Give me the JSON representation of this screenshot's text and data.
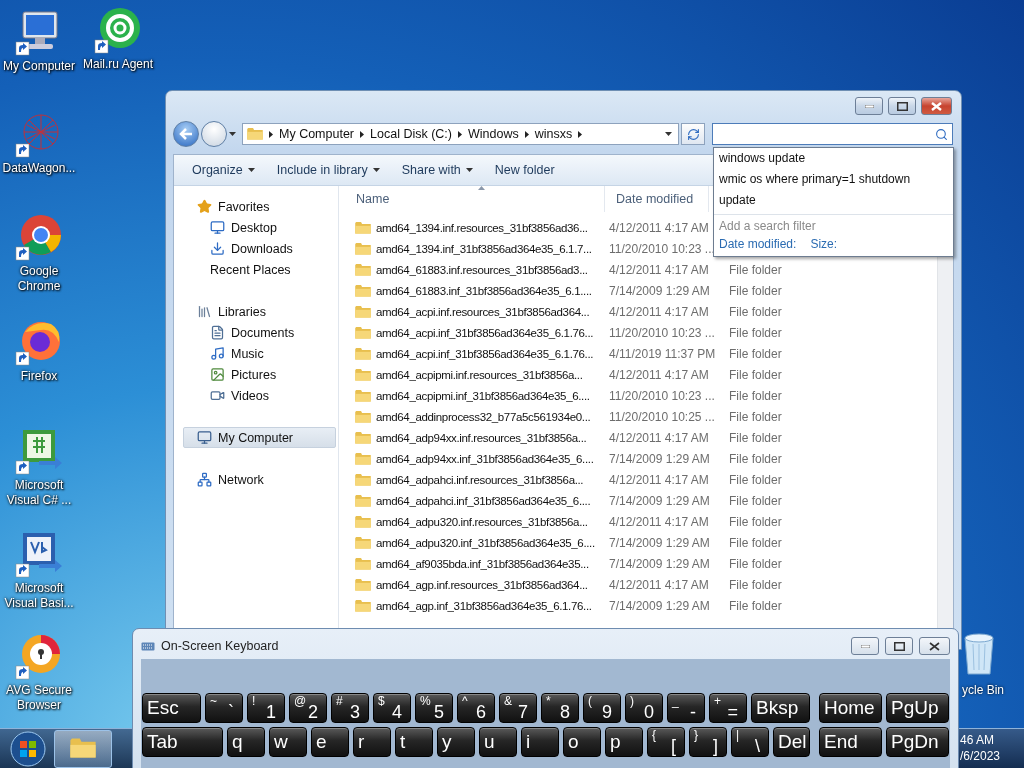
{
  "desktop_icons": [
    {
      "label": "My Computer",
      "kind": "computer"
    },
    {
      "label": "Mail.ru Agent",
      "kind": "mail"
    },
    {
      "label": "DataWagon...",
      "kind": "web"
    },
    {
      "label": "Google Chrome",
      "kind": "chrome"
    },
    {
      "label": "Firefox",
      "kind": "firefox"
    },
    {
      "label": "Microsoft Visual C# ...",
      "kind": "csharp"
    },
    {
      "label": "Microsoft Visual Basi...",
      "kind": "vb"
    },
    {
      "label": "AVG Secure Browser",
      "kind": "avg"
    }
  ],
  "recycle_bin": {
    "label": "ycle Bin"
  },
  "explorer": {
    "breadcrumbs": [
      "My Computer",
      "Local Disk (C:)",
      "Windows",
      "winsxs"
    ],
    "search": {
      "suggestions": [
        "windows update",
        "wmic os where primary=1 shutdown",
        "update"
      ],
      "filter_hint": "Add a search filter",
      "filters": [
        "Date modified:",
        "Size:"
      ]
    },
    "toolbar": [
      {
        "label": "Organize",
        "menu": true
      },
      {
        "label": "Include in library",
        "menu": true
      },
      {
        "label": "Share with",
        "menu": true
      },
      {
        "label": "New folder",
        "menu": false
      }
    ],
    "nav": [
      {
        "label": "Favorites",
        "kind": "star",
        "selected": false,
        "children": [
          {
            "label": "Desktop",
            "kind": "desktop",
            "selected": false
          },
          {
            "label": "Downloads",
            "kind": "downloads",
            "selected": false
          },
          {
            "label": "Recent Places",
            "kind": "recent",
            "selected": false
          }
        ]
      },
      {
        "label": "Libraries",
        "kind": "library",
        "selected": false,
        "children": [
          {
            "label": "Documents",
            "kind": "documents",
            "selected": false
          },
          {
            "label": "Music",
            "kind": "music",
            "selected": false
          },
          {
            "label": "Pictures",
            "kind": "pictures",
            "selected": false
          },
          {
            "label": "Videos",
            "kind": "videos",
            "selected": false
          }
        ]
      },
      {
        "label": "My Computer",
        "kind": "computer",
        "selected": true
      },
      {
        "label": "Network",
        "kind": "network",
        "selected": false
      }
    ],
    "columns": [
      "Name",
      "Date modified"
    ],
    "rows": [
      {
        "name": "amd64_1394.inf.resources_31bf3856ad36...",
        "date": "4/12/2011 4:17 AM"
      },
      {
        "name": "amd64_1394.inf_31bf3856ad364e35_6.1.7...",
        "date": "11/20/2010 10:23 ..."
      },
      {
        "name": "amd64_61883.inf.resources_31bf3856ad3...",
        "date": "4/12/2011 4:17 AM",
        "type": "File folder"
      },
      {
        "name": "amd64_61883.inf_31bf3856ad364e35_6.1....",
        "date": "7/14/2009 1:29 AM",
        "type": "File folder"
      },
      {
        "name": "amd64_acpi.inf.resources_31bf3856ad364...",
        "date": "4/12/2011 4:17 AM",
        "type": "File folder"
      },
      {
        "name": "amd64_acpi.inf_31bf3856ad364e35_6.1.76...",
        "date": "11/20/2010 10:23 ...",
        "type": "File folder"
      },
      {
        "name": "amd64_acpi.inf_31bf3856ad364e35_6.1.76...",
        "date": "4/11/2019 11:37 PM",
        "type": "File folder"
      },
      {
        "name": "amd64_acpipmi.inf.resources_31bf3856a...",
        "date": "4/12/2011 4:17 AM",
        "type": "File folder"
      },
      {
        "name": "amd64_acpipmi.inf_31bf3856ad364e35_6....",
        "date": "11/20/2010 10:23 ...",
        "type": "File folder"
      },
      {
        "name": "amd64_addinprocess32_b77a5c561934e0...",
        "date": "11/20/2010 10:25 ...",
        "type": "File folder"
      },
      {
        "name": "amd64_adp94xx.inf.resources_31bf3856a...",
        "date": "4/12/2011 4:17 AM",
        "type": "File folder"
      },
      {
        "name": "amd64_adp94xx.inf_31bf3856ad364e35_6....",
        "date": "7/14/2009 1:29 AM",
        "type": "File folder"
      },
      {
        "name": "amd64_adpahci.inf.resources_31bf3856a...",
        "date": "4/12/2011 4:17 AM",
        "type": "File folder"
      },
      {
        "name": "amd64_adpahci.inf_31bf3856ad364e35_6....",
        "date": "7/14/2009 1:29 AM",
        "type": "File folder"
      },
      {
        "name": "amd64_adpu320.inf.resources_31bf3856a...",
        "date": "4/12/2011 4:17 AM",
        "type": "File folder"
      },
      {
        "name": "amd64_adpu320.inf_31bf3856ad364e35_6....",
        "date": "7/14/2009 1:29 AM",
        "type": "File folder"
      },
      {
        "name": "amd64_af9035bda.inf_31bf3856ad364e35...",
        "date": "7/14/2009 1:29 AM",
        "type": "File folder"
      },
      {
        "name": "amd64_agp.inf.resources_31bf3856ad364...",
        "date": "4/12/2011 4:17 AM",
        "type": "File folder"
      },
      {
        "name": "amd64_agp.inf_31bf3856ad364e35_6.1.76...",
        "date": "7/14/2009 1:29 AM",
        "type": "File folder"
      }
    ]
  },
  "keyboard": {
    "title": "On-Screen Keyboard",
    "rows": [
      [
        {
          "main": "Esc",
          "kind": "esc"
        },
        {
          "top": "~",
          "main": "`",
          "kind": "std"
        },
        {
          "top": "!",
          "main": "1",
          "kind": "std"
        },
        {
          "top": "@",
          "main": "2",
          "kind": "std"
        },
        {
          "top": "#",
          "main": "3",
          "kind": "std"
        },
        {
          "top": "$",
          "main": "4",
          "kind": "std"
        },
        {
          "top": "%",
          "main": "5",
          "kind": "std"
        },
        {
          "top": "^",
          "main": "6",
          "kind": "std"
        },
        {
          "top": "&",
          "main": "7",
          "kind": "std"
        },
        {
          "top": "*",
          "main": "8",
          "kind": "std"
        },
        {
          "top": "(",
          "main": "9",
          "kind": "std"
        },
        {
          "top": ")",
          "main": "0",
          "kind": "std"
        },
        {
          "top": "_",
          "main": "-",
          "kind": "std"
        },
        {
          "top": "+",
          "main": "=",
          "kind": "std"
        },
        {
          "main": "Bksp",
          "kind": "esc"
        },
        {
          "main": "Home",
          "kind": "nav"
        },
        {
          "main": "PgUp",
          "kind": "nav"
        }
      ],
      [
        {
          "main": "Tab",
          "kind": "tab"
        },
        {
          "main": "q",
          "kind": "std"
        },
        {
          "main": "w",
          "kind": "std"
        },
        {
          "main": "e",
          "kind": "std"
        },
        {
          "main": "r",
          "kind": "std"
        },
        {
          "main": "t",
          "kind": "std"
        },
        {
          "main": "y",
          "kind": "std"
        },
        {
          "main": "u",
          "kind": "std"
        },
        {
          "main": "i",
          "kind": "std"
        },
        {
          "main": "o",
          "kind": "std"
        },
        {
          "main": "p",
          "kind": "std"
        },
        {
          "top": "{",
          "main": "[",
          "kind": "std"
        },
        {
          "top": "}",
          "main": "]",
          "kind": "std"
        },
        {
          "top": "|",
          "main": "\\",
          "kind": "std"
        },
        {
          "main": "Del",
          "kind": "del"
        },
        {
          "main": "End",
          "kind": "nav"
        },
        {
          "main": "PgDn",
          "kind": "nav"
        }
      ]
    ]
  },
  "taskbar": {
    "clock": [
      "46 AM",
      "/6/2023"
    ]
  }
}
